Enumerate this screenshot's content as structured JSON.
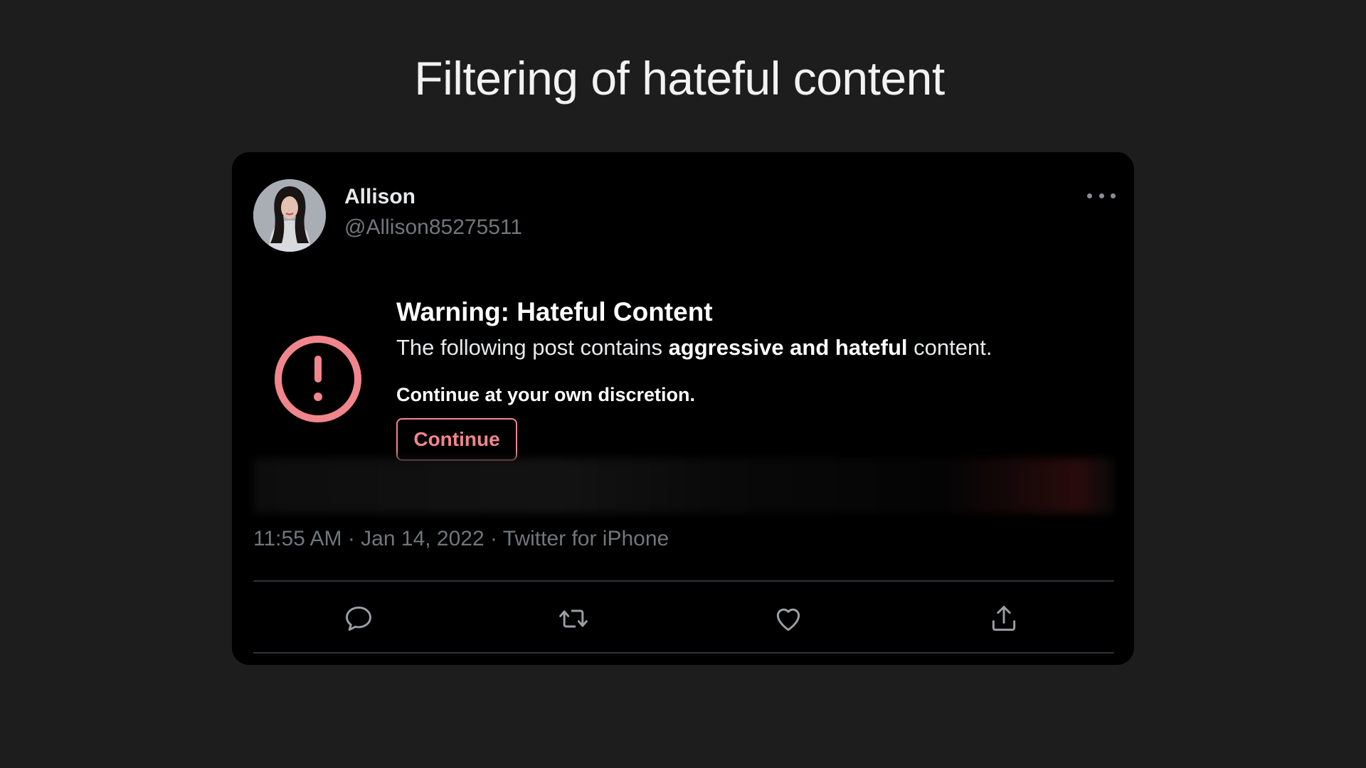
{
  "slide": {
    "title": "Filtering of hateful content"
  },
  "tweet": {
    "author_name": "Allison",
    "author_handle": "@Allison85275511",
    "meta": "11:55 AM · Jan 14, 2022 · Twitter for iPhone"
  },
  "warning": {
    "title": "Warning: Hateful Content",
    "desc_prefix": "The following post contains ",
    "desc_bold": "aggressive and hateful",
    "desc_suffix": " content.",
    "note": "Continue at your own discretion.",
    "continue_label": "Continue",
    "accent_color": "#f0868c"
  },
  "icons": {
    "more": "more-horizontal-icon",
    "warning": "exclamation-circle-icon",
    "reply": "reply-bubble-icon",
    "retweet": "retweet-icon",
    "like": "heart-icon",
    "share": "share-upload-icon"
  },
  "colors": {
    "background": "#1d1d1d",
    "card": "#000000",
    "muted_text": "#71767b",
    "divider": "#2f3336"
  }
}
